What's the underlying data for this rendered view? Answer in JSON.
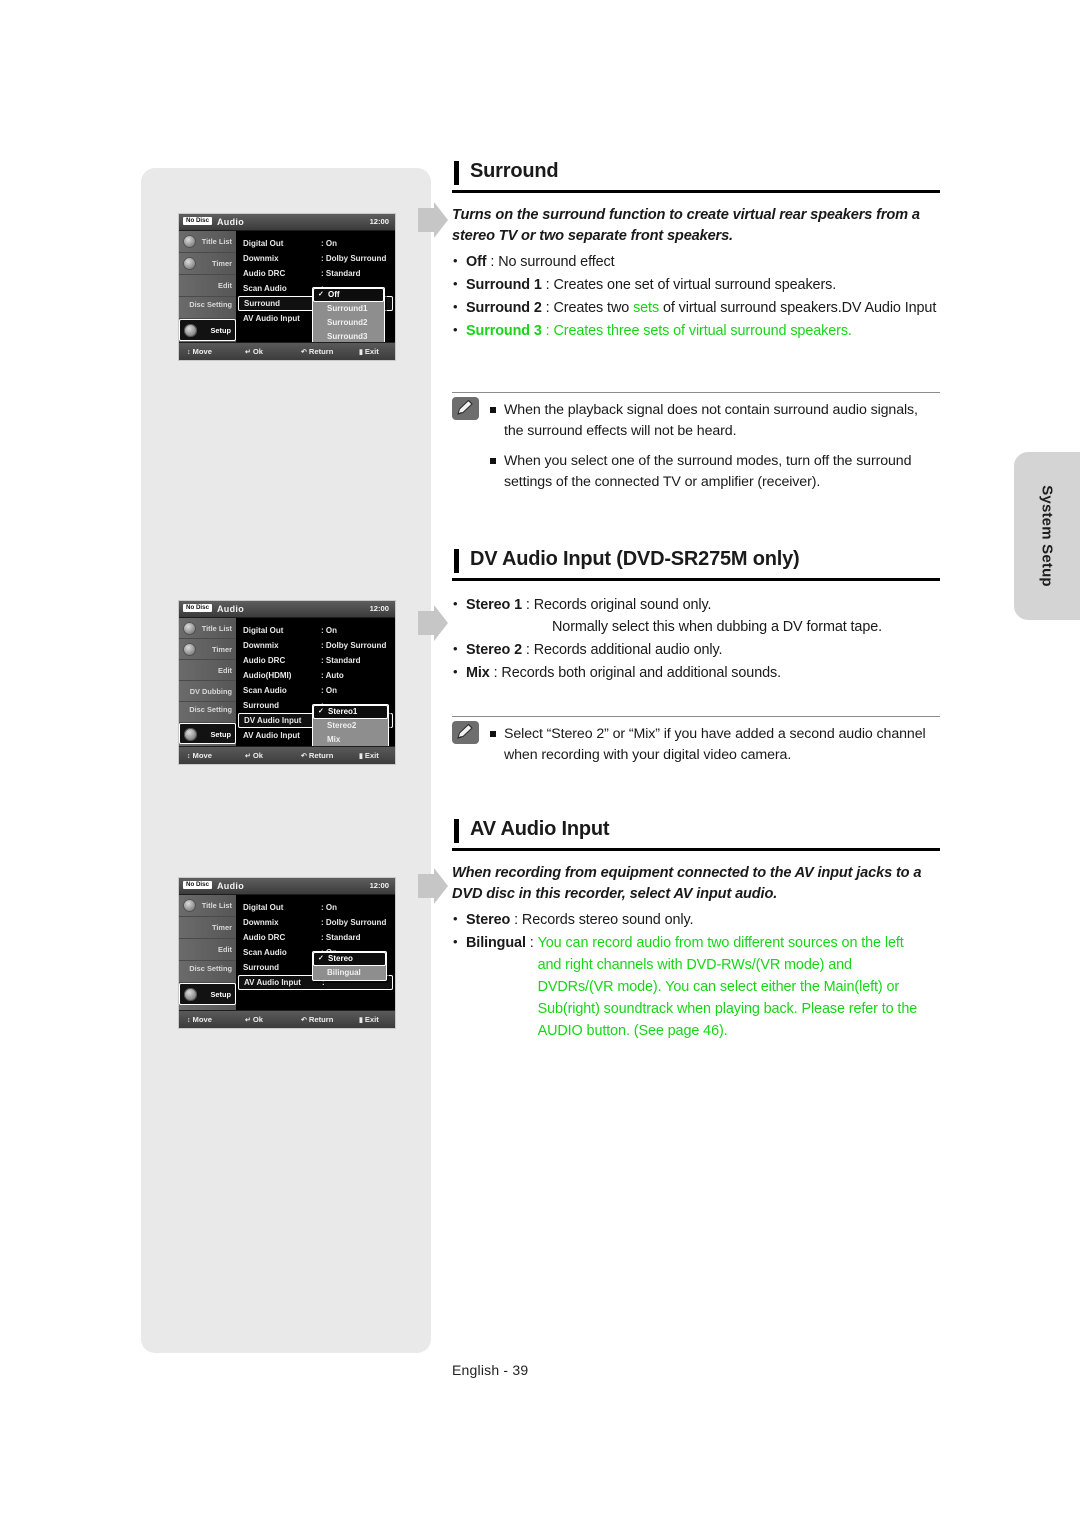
{
  "page": {
    "footer": "English - 39",
    "side_tab": "System Setup",
    "accent_green": "#16d616"
  },
  "sections": {
    "surround": {
      "title": "Surround",
      "intro": "Turns on the surround function to create virtual rear speakers from a stereo TV or two separate front speakers.",
      "items": [
        {
          "term": "Off",
          "sep": " : ",
          "desc": "No surround effect"
        },
        {
          "term": "Surround 1",
          "sep": " : ",
          "desc": "Creates one set of virtual surround speakers."
        },
        {
          "term": "Surround 2",
          "sep": " : ",
          "desc_a": "Creates two ",
          "desc_green": "sets",
          "desc_b": " of virtual surround speakers.DV Audio Input"
        },
        {
          "term": "Surround 3",
          "sep": " : ",
          "desc": "Creates three sets of virtual surround speakers."
        }
      ],
      "notes": [
        "When the playback signal does not contain surround audio signals, the surround effects will not be heard.",
        "When you select one of the surround modes, turn off the surround settings of the connected TV or amplifier (receiver)."
      ]
    },
    "dv_audio_input": {
      "title": "DV Audio Input (DVD-SR275M only)",
      "items": [
        {
          "term": "Stereo 1",
          "sep": " : ",
          "desc": "Records original sound only.",
          "desc2": "Normally select this when dubbing a DV format tape."
        },
        {
          "term": "Stereo 2",
          "sep": " : ",
          "desc": "Records additional audio only."
        },
        {
          "term": "Mix",
          "sep": " : ",
          "desc": "Records both original and additional sounds."
        }
      ],
      "notes": [
        "Select “Stereo 2” or “Mix” if you have added a second audio channel when recording with your digital video camera."
      ]
    },
    "av_audio_input": {
      "title": "AV Audio Input",
      "intro": "When recording from equipment connected to the AV input jacks to a DVD disc in this recorder, select AV input audio.",
      "items": [
        {
          "term": "Stereo",
          "sep": " : ",
          "desc": "Records stereo sound only."
        },
        {
          "term": "Bilingual",
          "sep": " : ",
          "desc_green": "You can record audio from two different sources on the left and right channels with DVD-RWs/(VR mode) and DVDRs/(VR mode). You can select either the Main(left) or Sub(right) soundtrack when playing back. Please refer to the AUDIO button. (See page 46)."
        }
      ]
    }
  },
  "osd": {
    "header": {
      "badge": "No Disc",
      "title": "Audio",
      "time": "12:00"
    },
    "footer": [
      {
        "icon": "↕",
        "label": "Move"
      },
      {
        "icon": "↵",
        "label": "Ok"
      },
      {
        "icon": "↶",
        "label": "Return"
      },
      {
        "icon": "▮",
        "label": "Exit"
      }
    ],
    "screen1": {
      "sidebar": [
        "Title List",
        "Timer",
        "Edit",
        "Disc Setting",
        "Setup"
      ],
      "selected_sidebar": "Setup",
      "rows": [
        {
          "label": "Digital Out",
          "value": ": On"
        },
        {
          "label": "Downmix",
          "value": ": Dolby Surround"
        },
        {
          "label": "Audio DRC",
          "value": ": Standard"
        },
        {
          "label": "Scan Audio",
          "value": ":"
        },
        {
          "label": "Surround",
          "value": ":"
        },
        {
          "label": "AV Audio Input",
          "value": ":"
        }
      ],
      "selected_row": "Surround",
      "dropdown": {
        "current": "Off",
        "options": [
          "Off",
          "Surround1",
          "Surround2",
          "Surround3"
        ]
      }
    },
    "screen2": {
      "sidebar": [
        "Title List",
        "Timer",
        "Edit",
        "DV Dubbing",
        "Disc Setting",
        "Setup"
      ],
      "selected_sidebar": "Setup",
      "rows": [
        {
          "label": "Digital Out",
          "value": ": On"
        },
        {
          "label": "Downmix",
          "value": ": Dolby Surround"
        },
        {
          "label": "Audio DRC",
          "value": ": Standard"
        },
        {
          "label": "Audio(HDMI)",
          "value": ": Auto"
        },
        {
          "label": "Scan Audio",
          "value": ": On"
        },
        {
          "label": "Surround",
          "value": ":"
        },
        {
          "label": "DV Audio Input",
          "value": ":"
        },
        {
          "label": "AV Audio Input",
          "value": ":"
        }
      ],
      "selected_row": "DV Audio Input",
      "dropdown": {
        "current": "Stereo1",
        "options": [
          "Stereo1",
          "Stereo2",
          "Mix"
        ]
      }
    },
    "screen3": {
      "sidebar": [
        "Title List",
        "Timer",
        "Edit",
        "Disc Setting",
        "Setup"
      ],
      "selected_sidebar": "Setup",
      "rows": [
        {
          "label": "Digital Out",
          "value": ": On"
        },
        {
          "label": "Downmix",
          "value": ": Dolby Surround"
        },
        {
          "label": "Audio DRC",
          "value": ": Standard"
        },
        {
          "label": "Scan Audio",
          "value": ": On"
        },
        {
          "label": "Surround",
          "value": ":"
        },
        {
          "label": "AV Audio Input",
          "value": ":"
        }
      ],
      "selected_row": "AV Audio Input",
      "dropdown": {
        "current": "Stereo",
        "options": [
          "Stereo",
          "Bilingual"
        ]
      }
    }
  }
}
